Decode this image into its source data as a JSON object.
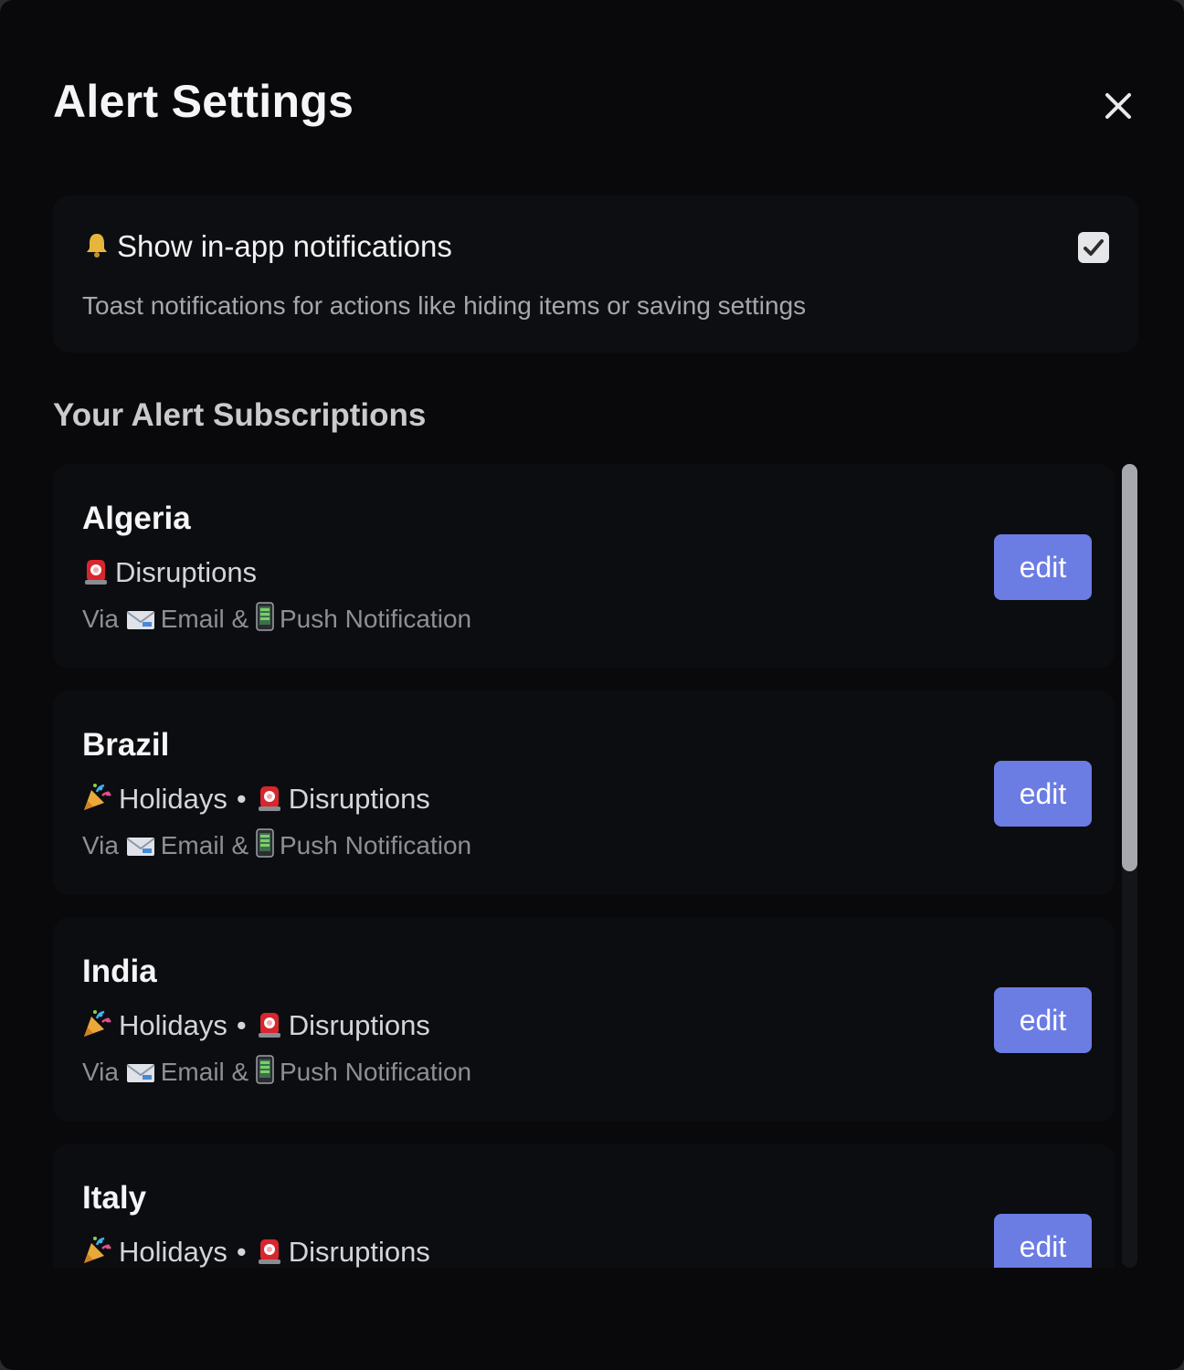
{
  "modal": {
    "title": "Alert Settings",
    "close_icon": "close-icon"
  },
  "in_app": {
    "label": "Show in-app notifications",
    "icon": "bell-icon",
    "description": "Toast notifications for actions like hiding items or saving settings",
    "checked": true
  },
  "subscriptions": {
    "heading": "Your Alert Subscriptions",
    "edit_label": "edit",
    "bullet": "•",
    "via_prefix": "Via",
    "via_separator": "&",
    "items": [
      {
        "name": "Algeria",
        "types": [
          {
            "icon": "siren-icon",
            "label": "Disruptions"
          }
        ],
        "channels": [
          {
            "icon": "envelope-icon",
            "label": "Email"
          },
          {
            "icon": "mobile-phone-icon",
            "label": "Push Notification"
          }
        ]
      },
      {
        "name": "Brazil",
        "types": [
          {
            "icon": "party-popper-icon",
            "label": "Holidays"
          },
          {
            "icon": "siren-icon",
            "label": "Disruptions"
          }
        ],
        "channels": [
          {
            "icon": "envelope-icon",
            "label": "Email"
          },
          {
            "icon": "mobile-phone-icon",
            "label": "Push Notification"
          }
        ]
      },
      {
        "name": "India",
        "types": [
          {
            "icon": "party-popper-icon",
            "label": "Holidays"
          },
          {
            "icon": "siren-icon",
            "label": "Disruptions"
          }
        ],
        "channels": [
          {
            "icon": "envelope-icon",
            "label": "Email"
          },
          {
            "icon": "mobile-phone-icon",
            "label": "Push Notification"
          }
        ]
      },
      {
        "name": "Italy",
        "types": [
          {
            "icon": "party-popper-icon",
            "label": "Holidays"
          },
          {
            "icon": "siren-icon",
            "label": "Disruptions"
          }
        ],
        "channels": []
      }
    ]
  },
  "colors": {
    "background": "#09090c",
    "card": "#0c0d10",
    "accent": "#6b7ce3",
    "muted_text": "#8e8f95"
  }
}
